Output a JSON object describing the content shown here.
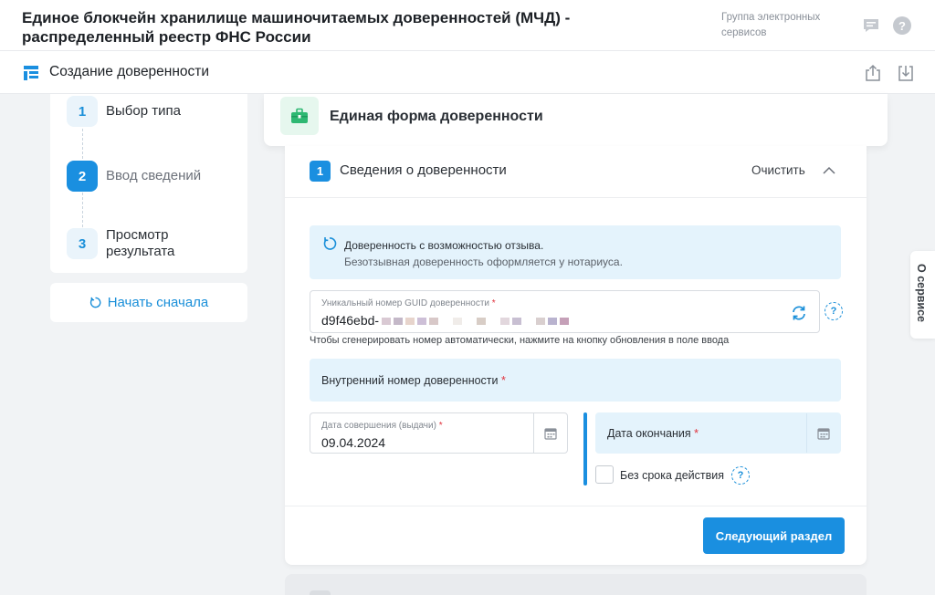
{
  "header": {
    "title": "Единое блокчейн хранилище машиночитаемых доверенностей (МЧД) - распределенный реестр ФНС России",
    "group": "Группа электронных сервисов",
    "icons": [
      "chat-icon",
      "help-icon"
    ],
    "help_glyph": "?"
  },
  "subheader": {
    "title": "Создание доверенности",
    "icons": [
      "share-icon",
      "download-icon"
    ]
  },
  "steps": [
    {
      "num": "1",
      "label": "Выбор типа"
    },
    {
      "num": "2",
      "label": "Ввод сведений"
    },
    {
      "num": "3",
      "label": "Просмотр результата"
    }
  ],
  "restart_label": "Начать сначала",
  "form": {
    "title": "Единая форма доверенности"
  },
  "section": {
    "num": "1",
    "title": "Сведения о доверенности",
    "clear_label": "Очистить",
    "info_line1": "Доверенность с возможностью отзыва.",
    "info_line2": "Безотзывная доверенность оформляется у нотариуса.",
    "guid_label": "Уникальный номер GUID доверенности",
    "guid_value": "d9f46ebd-",
    "guid_hint": "Чтобы сгенерировать номер автоматически, нажмите на кнопку обновления в поле ввода",
    "internal_label": "Внутренний номер доверенности",
    "issue_label": "Дата совершения (выдачи)",
    "issue_value": "09.04.2024",
    "end_label": "Дата окончания",
    "no_term_label": "Без срока действия",
    "required_mark": "*",
    "help_glyph": "?",
    "next_label": "Следующий раздел"
  },
  "about_tab": "О сервисе",
  "colors": {
    "accent": "#1a8fe0",
    "info_bg": "#e4f3fc",
    "required": "#e0323c"
  }
}
